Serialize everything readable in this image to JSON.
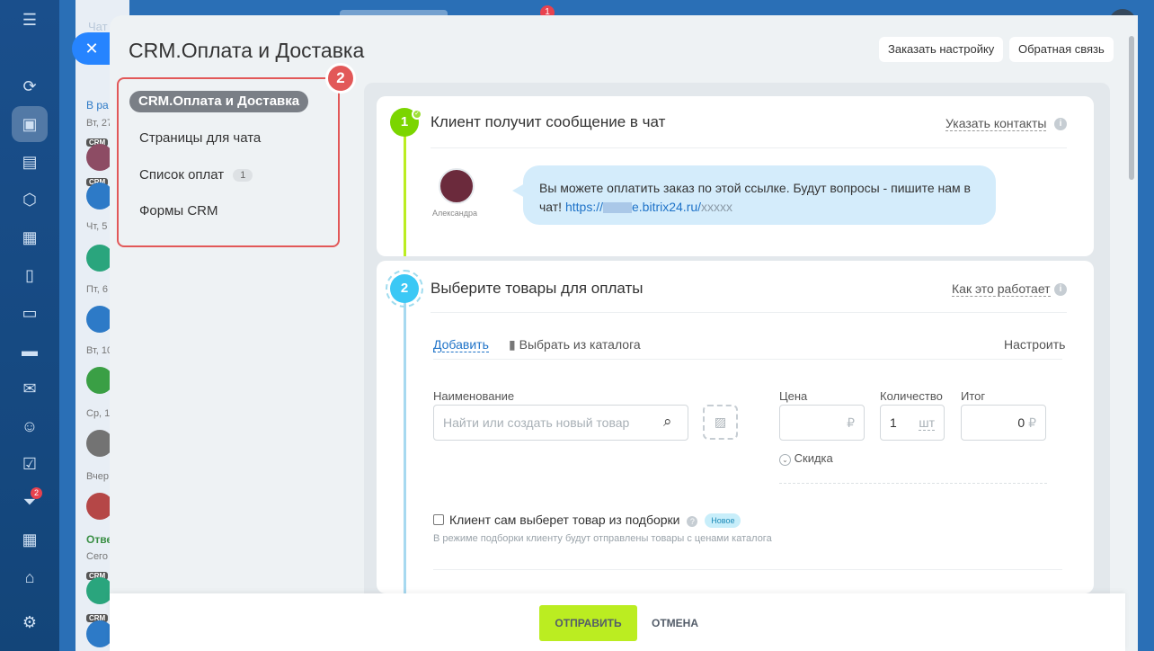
{
  "background": {
    "chat_header": "Чат",
    "top_badge": "1",
    "sidebar_badge": "2",
    "chat_list": {
      "section1": "В ра",
      "date1": "Вт, 27",
      "date2": "Чт, 5",
      "date3": "Пт, 6",
      "date4": "Вт, 10",
      "date5": "Ср, 1",
      "date6": "Вчер",
      "section2": "Отве",
      "date7": "Сего",
      "crm": "CRM"
    }
  },
  "header": {
    "title": "CRM.Оплата и Доставка",
    "order_setup": "Заказать настройку",
    "feedback": "Обратная связь"
  },
  "menu": {
    "highlight_number": "2",
    "items": [
      {
        "label": "CRM.Оплата и Доставка"
      },
      {
        "label": "Страницы для чата"
      },
      {
        "label": "Список оплат",
        "count": "1"
      },
      {
        "label": "Формы CRM"
      }
    ]
  },
  "step1": {
    "number": "1",
    "title": "Клиент получит сообщение в чат",
    "link": "Указать контакты",
    "sender_name": "Александра",
    "message": "Вы можете оплатить заказ по этой ссылке. Будут вопросы - пишите нам в чат!",
    "link_prefix": "https://",
    "link_domain": "e.bitrix24.ru/",
    "link_suffix": "xxxxx"
  },
  "step2": {
    "number": "2",
    "title": "Выберите товары для оплаты",
    "how_link": "Как это работает",
    "add": "Добавить",
    "catalog": "Выбрать из каталога",
    "configure": "Настроить",
    "name_label": "Наименование",
    "name_placeholder": "Найти или создать новый товар",
    "price_label": "Цена",
    "currency": "₽",
    "qty_label": "Количество",
    "qty_value": "1",
    "qty_unit": "шт",
    "total_label": "Итог",
    "total_value": "0",
    "discount": "Скидка",
    "client_choice": "Клиент сам выберет товар из подборки",
    "new_badge": "Новое",
    "client_choice_hint": "В режиме подборки клиенту будут отправлены товары с ценами каталога"
  },
  "footer": {
    "send": "ОТПРАВИТЬ",
    "cancel": "ОТМЕНА"
  }
}
